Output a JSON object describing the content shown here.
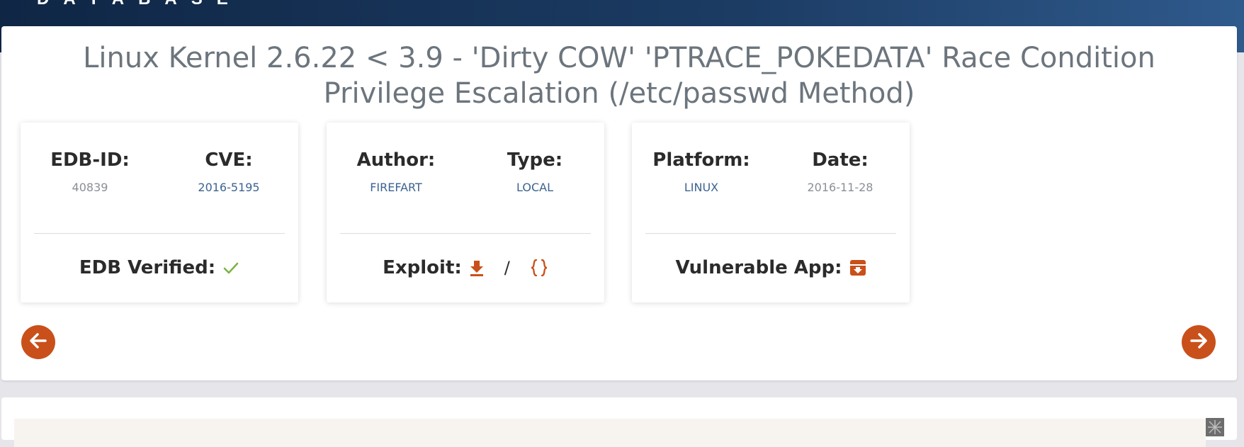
{
  "header": {
    "brand": "DATABASE"
  },
  "exploit": {
    "title": "Linux Kernel 2.6.22 < 3.9 - 'Dirty COW' 'PTRACE_POKEDATA' Race Condition Privilege Escalation (/etc/passwd Method)"
  },
  "cards": {
    "card1": {
      "edb_id_label": "EDB-ID:",
      "edb_id_value": "40839",
      "cve_label": "CVE:",
      "cve_value": "2016-5195",
      "verified_label": "EDB Verified:",
      "verified_icon": "checkmark-icon"
    },
    "card2": {
      "author_label": "Author:",
      "author_value": "FIREFART",
      "type_label": "Type:",
      "type_value": "LOCAL",
      "exploit_label": "Exploit:",
      "download_icon": "download-icon",
      "separator": "/",
      "code_icon": "code-braces-icon"
    },
    "card3": {
      "platform_label": "Platform:",
      "platform_value": "LINUX",
      "date_label": "Date:",
      "date_value": "2016-11-28",
      "vulnerable_app_label": "Vulnerable App:",
      "vulnerable_app_icon": "archive-icon"
    }
  },
  "navigation": {
    "prev_icon": "arrow-left-icon",
    "next_icon": "arrow-right-icon"
  },
  "colors": {
    "accent": "#c9501a",
    "link": "#3d6390",
    "verified": "#7cb342",
    "header_start": "#0f2645",
    "header_end": "#2f5a8c"
  }
}
